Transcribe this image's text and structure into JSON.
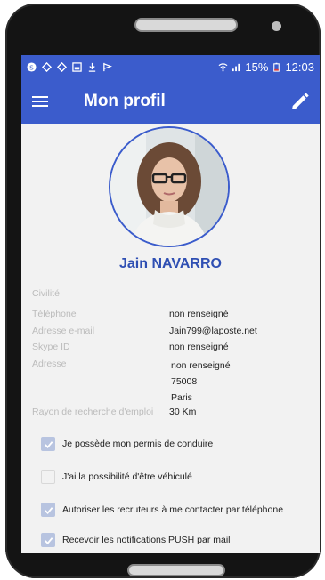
{
  "status": {
    "battery": "15%",
    "time": "12:03"
  },
  "appbar": {
    "title": "Mon profil"
  },
  "profile": {
    "name": "Jain NAVARRO"
  },
  "fields": [
    {
      "label": "Civilité",
      "value": ""
    },
    {
      "label": "Téléphone",
      "value": "non renseigné"
    },
    {
      "label": "Adresse e-mail",
      "value": "Jain799@laposte.net"
    },
    {
      "label": "Skype ID",
      "value": "non renseigné"
    },
    {
      "label": "Adresse",
      "value": "non renseigné",
      "value2": "75008",
      "value3": "Paris"
    },
    {
      "label": "Rayon de recherche d'emploi",
      "value": "30 Km"
    }
  ],
  "checkboxes": [
    {
      "label": "Je possède mon permis de conduire",
      "checked": true
    },
    {
      "label": "J'ai la possibilité d'être véhiculé",
      "checked": false
    },
    {
      "label": "Autoriser les recruteurs à me contacter par téléphone",
      "checked": true
    },
    {
      "label": "Recevoir les notifications PUSH par mail",
      "checked": true
    }
  ],
  "colors": {
    "primary": "#3b5ccc",
    "name": "#2f4fb3"
  }
}
